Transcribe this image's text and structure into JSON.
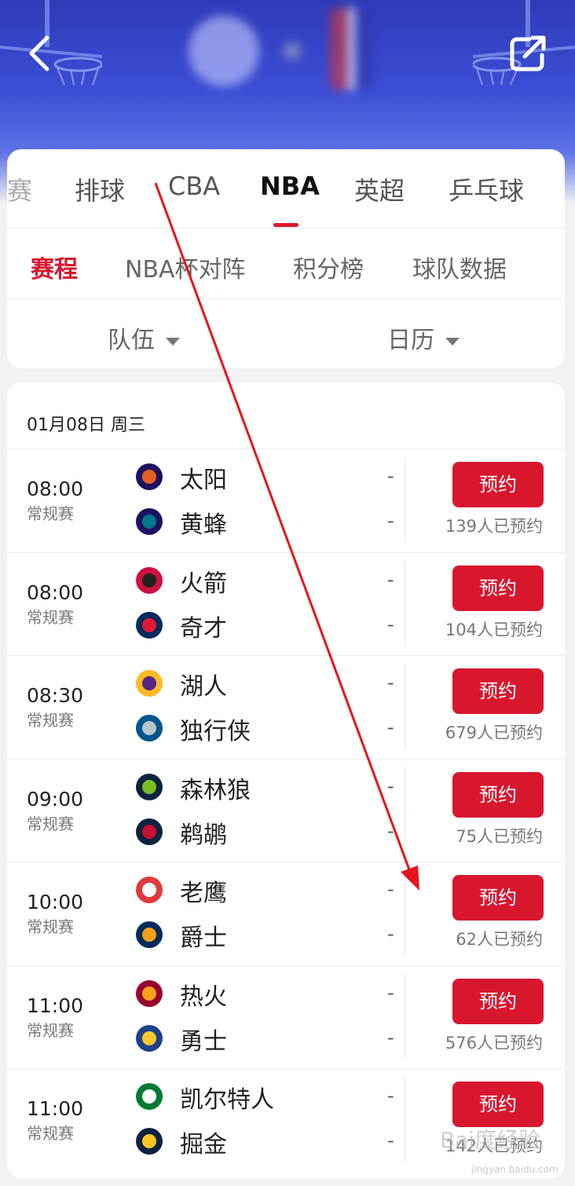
{
  "header": {
    "back_icon": "chevron-left-icon",
    "share_icon": "share-out-icon"
  },
  "sport_tabs": [
    {
      "label": "赛"
    },
    {
      "label": "排球"
    },
    {
      "label": "CBA"
    },
    {
      "label": "NBA",
      "active": true
    },
    {
      "label": "英超"
    },
    {
      "label": "乒乓球"
    }
  ],
  "sub_tabs": [
    {
      "label": "赛程",
      "active": true
    },
    {
      "label": "NBA杯对阵"
    },
    {
      "label": "积分榜"
    },
    {
      "label": "球队数据"
    }
  ],
  "filters": {
    "team": "队伍",
    "calendar": "日历"
  },
  "schedule": {
    "date": "01月08日 周三",
    "reserve_label": "预约",
    "games": [
      {
        "time": "08:00",
        "stage": "常规赛",
        "home": "太阳",
        "away": "黄蜂",
        "home_score": "-",
        "away_score": "-",
        "count": "139人已预约",
        "home_logo": "suns-logo-icon",
        "away_logo": "hornets-logo-icon"
      },
      {
        "time": "08:00",
        "stage": "常规赛",
        "home": "火箭",
        "away": "奇才",
        "home_score": "-",
        "away_score": "-",
        "count": "104人已预约",
        "home_logo": "rockets-logo-icon",
        "away_logo": "wizards-logo-icon"
      },
      {
        "time": "08:30",
        "stage": "常规赛",
        "home": "湖人",
        "away": "独行侠",
        "home_score": "-",
        "away_score": "-",
        "count": "679人已预约",
        "home_logo": "lakers-logo-icon",
        "away_logo": "mavericks-logo-icon"
      },
      {
        "time": "09:00",
        "stage": "常规赛",
        "home": "森林狼",
        "away": "鹈鹕",
        "home_score": "-",
        "away_score": "-",
        "count": "75人已预约",
        "home_logo": "timberwolves-logo-icon",
        "away_logo": "pelicans-logo-icon"
      },
      {
        "time": "10:00",
        "stage": "常规赛",
        "home": "老鹰",
        "away": "爵士",
        "home_score": "-",
        "away_score": "-",
        "count": "62人已预约",
        "home_logo": "hawks-logo-icon",
        "away_logo": "jazz-logo-icon"
      },
      {
        "time": "11:00",
        "stage": "常规赛",
        "home": "热火",
        "away": "勇士",
        "home_score": "-",
        "away_score": "-",
        "count": "576人已预约",
        "home_logo": "heat-logo-icon",
        "away_logo": "warriors-logo-icon"
      },
      {
        "time": "11:00",
        "stage": "常规赛",
        "home": "凯尔特人",
        "away": "掘金",
        "home_score": "-",
        "away_score": "-",
        "count": "142人已预约",
        "home_logo": "celtics-logo-icon",
        "away_logo": "nuggets-logo-icon"
      }
    ]
  },
  "watermark": {
    "text": "Bai度经验",
    "sub": "jingyan.baidu.com"
  },
  "colors": {
    "accent": "#d8172f",
    "header_blue": "#3b4fd6",
    "annotation_arrow": "#e8141c"
  }
}
